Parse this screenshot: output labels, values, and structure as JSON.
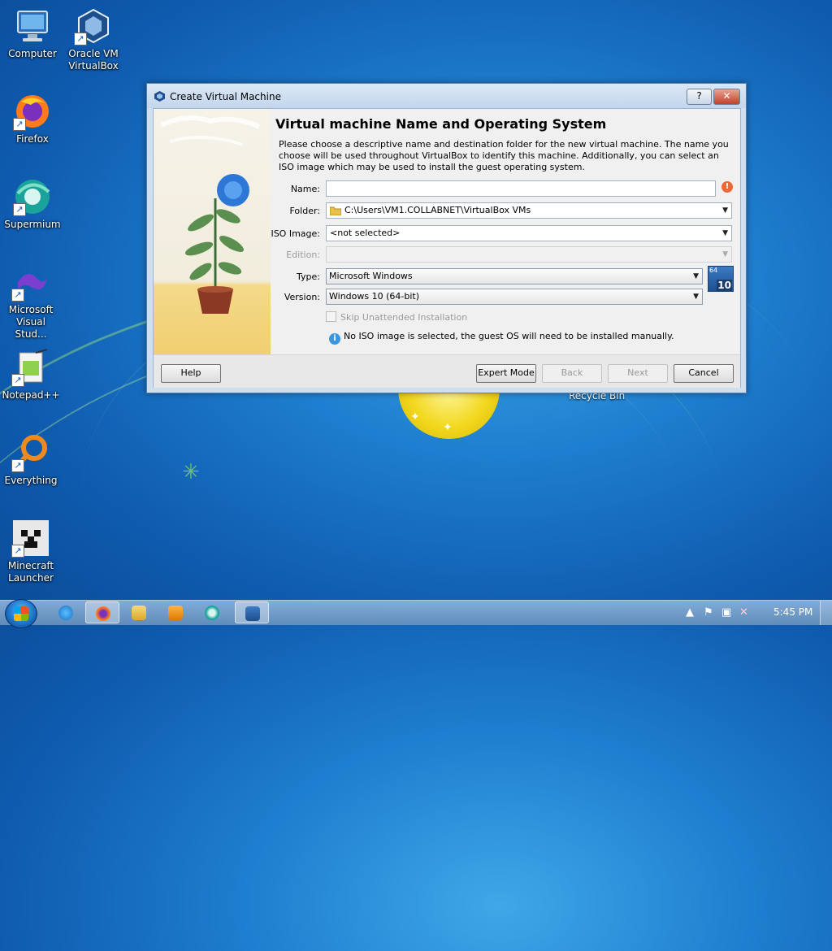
{
  "desktop": {
    "icons": [
      {
        "label": "Computer"
      },
      {
        "label": "Oracle VM VirtualBox"
      },
      {
        "label": "Firefox"
      },
      {
        "label": "Supermium"
      },
      {
        "label": "Microsoft Visual Stud..."
      },
      {
        "label": "Notepad++"
      },
      {
        "label": "Everything"
      },
      {
        "label": "Minecraft Launcher"
      }
    ],
    "recycle_bin_label": "Recycle Bin"
  },
  "dialog": {
    "title": "Create Virtual Machine",
    "heading": "Virtual machine Name and Operating System",
    "description": "Please choose a descriptive name and destination folder for the new virtual machine. The name you choose will be used throughout VirtualBox to identify this machine. Additionally, you can select an ISO image which may be used to install the guest operating system.",
    "fields": {
      "name_label": "Name:",
      "name_value": "",
      "folder_label": "Folder:",
      "folder_value": "C:\\Users\\VM1.COLLABNET\\VirtualBox VMs",
      "iso_label": "ISO Image:",
      "iso_value": "<not selected>",
      "edition_label": "Edition:",
      "edition_value": "",
      "type_label": "Type:",
      "type_value": "Microsoft Windows",
      "version_label": "Version:",
      "version_value": "Windows 10 (64-bit)",
      "os_badge_top": "64",
      "os_badge_bottom": "10"
    },
    "skip_unattended_label": "Skip Unattended Installation",
    "info_message": "No ISO image is selected, the guest OS will need to be installed manually.",
    "buttons": {
      "help": "Help",
      "expert_mode": "Expert Mode",
      "back": "Back",
      "next": "Next",
      "cancel": "Cancel"
    },
    "title_buttons": {
      "help": "?",
      "close": "✕"
    }
  },
  "taskbar": {
    "clock": "5:45 PM",
    "pinned": [
      "Internet Explorer",
      "Firefox",
      "Windows Explorer",
      "Media Player",
      "Supermium",
      "Oracle VM VirtualBox"
    ]
  },
  "colors": {
    "accent": "#1f7fd0",
    "warning": "#e86a3a",
    "info": "#3b96e0"
  }
}
